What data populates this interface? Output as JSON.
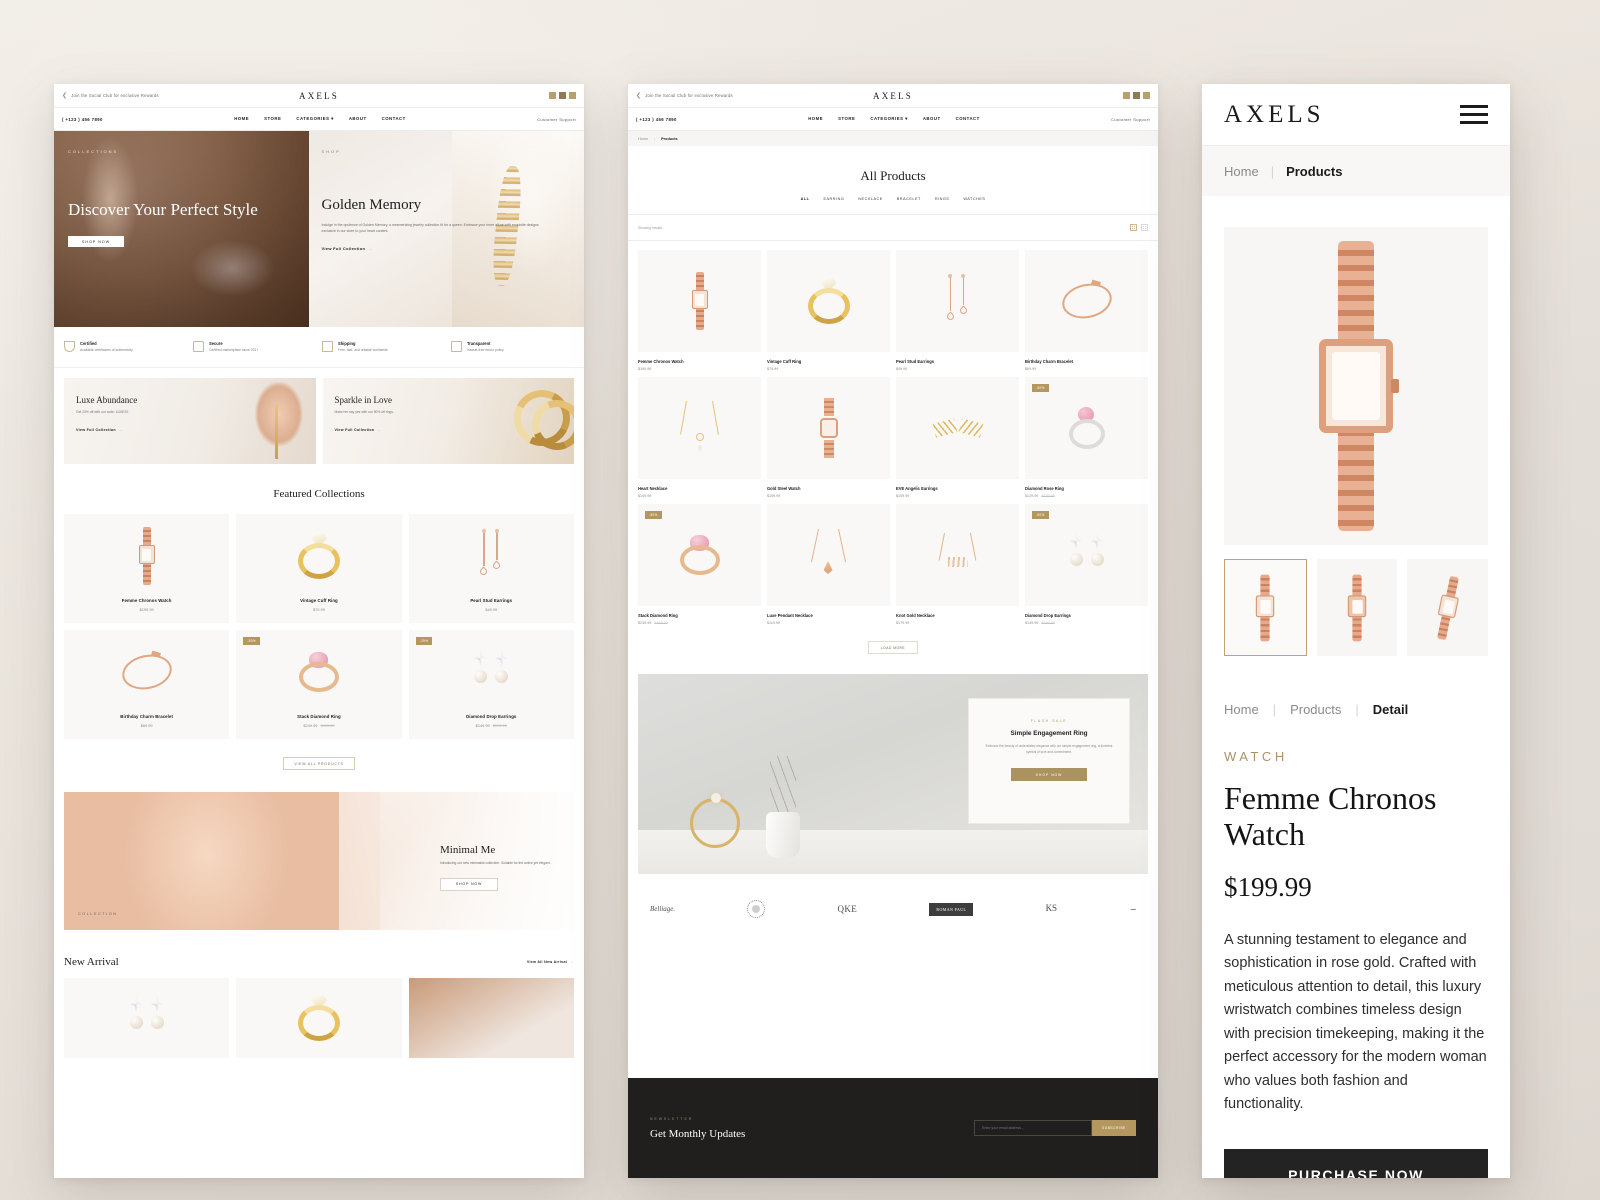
{
  "brand": "AXELS",
  "home": {
    "topbar": {
      "promo": "Join the Social Club for exclusive Rewards",
      "logo": "AXELS"
    },
    "nav": {
      "phone": "( +123 ) 456 7890",
      "links": [
        "HOME",
        "STORE",
        "CATEGORIES",
        "ABOUT",
        "CONTACT"
      ],
      "support": "Customer Support"
    },
    "hero_left": {
      "eyebrow": "COLLECTIONS",
      "title": "Discover Your Perfect Style",
      "cta": "SHOP NOW"
    },
    "hero_right": {
      "eyebrow": "SHOP",
      "title": "Golden Memory",
      "body": "Indulge in the opulence of Golden Memory, a mesmerizing jewelry collection fit for a queen. Embrace your inner allure with exquisite designs exclusive in our store to your heart content.",
      "cta": "View Full Collection"
    },
    "badges": [
      {
        "icon": "diamond-icon",
        "title": "Certified",
        "text": "Available certificates of authenticity"
      },
      {
        "icon": "lock-icon",
        "title": "Secure",
        "text": "Certified marketplace since 2017"
      },
      {
        "icon": "truck-icon",
        "title": "Shipping",
        "text": "Free, fast, and reliable worldwide"
      },
      {
        "icon": "box-icon",
        "title": "Transparent",
        "text": "Hassle-free return policy"
      }
    ],
    "promos": [
      {
        "title": "Luxe Abundance",
        "text": "Get 20% off with our code: LUXE20.",
        "cta": "View Full Collection"
      },
      {
        "title": "Sparkle in Love",
        "text": "Make her say yes with our 50% off rings.",
        "cta": "View Full Collection"
      }
    ],
    "featured": {
      "title": "Featured Collections",
      "cta": "VIEW ALL PRODUCTS",
      "items": [
        {
          "name": "Femme Chronos Watch",
          "price": "$199.99",
          "old": "",
          "badge": "",
          "art": "watch"
        },
        {
          "name": "Vintage Cuff Ring",
          "price": "$79.99",
          "old": "",
          "badge": "",
          "art": "ring"
        },
        {
          "name": "Pearl Stud Earrings",
          "price": "$49.99",
          "old": "",
          "badge": "",
          "art": "ear"
        },
        {
          "name": "Birthday Charm Bracelet",
          "price": "$69.99",
          "old": "",
          "badge": "",
          "art": "bracelet"
        },
        {
          "name": "Stack Diamond Ring",
          "price": "$249.99",
          "old": "$499.99",
          "badge": "-50%",
          "art": "stackring"
        },
        {
          "name": "Diamond Drop Earrings",
          "price": "$149.99",
          "old": "$199.99",
          "badge": "-25%",
          "art": "pearlear"
        }
      ]
    },
    "minimal": {
      "title": "Minimal Me",
      "text": "Introducing our new minimalist collection. Suitable for the active yet elegant.",
      "cta": "SHOP NOW",
      "label": "COLLECTION"
    },
    "new_arrival": {
      "title": "New Arrival",
      "cta": "View All New Arrival"
    }
  },
  "products": {
    "breadcrumb": {
      "home": "Home",
      "current": "Products"
    },
    "title": "All Products",
    "filters": [
      "ALL",
      "EARRING",
      "NECKLACE",
      "BRACELET",
      "RINGS",
      "WATCHES"
    ],
    "showing": "Showing results.",
    "items": [
      {
        "name": "Femme Chronos Watch",
        "price": "$199.99",
        "old": "",
        "badge": "",
        "art": "watch"
      },
      {
        "name": "Vintage Cuff Ring",
        "price": "$79.99",
        "old": "",
        "badge": "",
        "art": "ring"
      },
      {
        "name": "Pearl Stud Earrings",
        "price": "$49.99",
        "old": "",
        "badge": "",
        "art": "ear"
      },
      {
        "name": "Birthday Charm Bracelet",
        "price": "$69.99",
        "old": "",
        "badge": "",
        "art": "bracelet"
      },
      {
        "name": "Heart Necklace",
        "price": "$149.99",
        "old": "",
        "badge": "",
        "art": "neck"
      },
      {
        "name": "Gold Steel Watch",
        "price": "$159.99",
        "old": "",
        "badge": "",
        "art": "goldwatch"
      },
      {
        "name": "EVE Angelic Earrings",
        "price": "$159.99",
        "old": "",
        "badge": "",
        "art": "leaf"
      },
      {
        "name": "Diamond Rose Ring",
        "price": "$129.99",
        "old": "$259.99",
        "badge": "-50%",
        "art": "pinkring"
      },
      {
        "name": "Stack Diamond Ring",
        "price": "$249.99",
        "old": "$499.99",
        "badge": "-50%",
        "art": "stackring"
      },
      {
        "name": "Luxe Pendant Necklace",
        "price": "$119.99",
        "old": "",
        "badge": "",
        "art": "lux"
      },
      {
        "name": "Knot Gold Necklace",
        "price": "$179.99",
        "old": "",
        "badge": "",
        "art": "knot"
      },
      {
        "name": "Diamond Drop Earrings",
        "price": "$149.99",
        "old": "$199.99",
        "badge": "-50%",
        "art": "pearlear"
      }
    ],
    "load_more": "LOAD MORE",
    "flash": {
      "eyebrow": "FLASH SALE",
      "title": "Simple Engagement Ring",
      "text": "Embrace the beauty of understated elegance with our simple engagement ring, a timeless symbol of love and commitment.",
      "cta": "SHOP NOW"
    },
    "brands": [
      "Belliage.",
      "badge-logo",
      "QKE",
      "ROMAN PAUL",
      "KS",
      "signature-logo"
    ],
    "newsletter": {
      "eyebrow": "NEWSLETTER",
      "title": "Get Monthly Updates",
      "placeholder": "Enter your email address...",
      "button": "SUBSCRIBE"
    }
  },
  "mobile": {
    "logo": "AXELS",
    "breadcrumb": {
      "home": "Home",
      "current": "Products"
    },
    "detail_breadcrumb": {
      "home": "Home",
      "products": "Products",
      "current": "Detail"
    },
    "category": "WATCH",
    "title": "Femme Chronos Watch",
    "price": "$199.99",
    "description": "A stunning testament to elegance and sophistication in rose gold. Crafted with meticulous attention to detail, this luxury wristwatch combines timeless design with precision timekeeping, making it the perfect accessory for the modern woman who values both fashion and functionality.",
    "buy": "PURCHASE NOW"
  },
  "colors": {
    "gold": "#b3975f",
    "dark": "#201f1d",
    "rose": "#dd9f7c"
  }
}
